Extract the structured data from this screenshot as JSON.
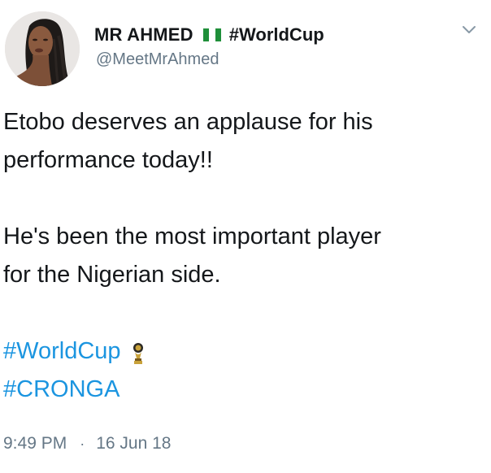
{
  "author": {
    "display_name": "MR AHMED",
    "flag_icon": "nigeria-flag-icon",
    "name_hashtag": "#WorldCup",
    "handle": "@MeetMrAhmed",
    "avatar_icon": "profile-avatar"
  },
  "menu": {
    "icon": "chevron-down-icon"
  },
  "tweet": {
    "paragraph1_line1": "Etobo deserves an applause for his",
    "paragraph1_line2": "performance today!!",
    "paragraph2_line1": "He's been the most important player",
    "paragraph2_line2": "for the Nigerian side.",
    "hashtag1": "#WorldCup",
    "hashtag1_icon": "world-cup-trophy-icon",
    "hashtag2": "#CRONGA"
  },
  "meta": {
    "time": "9:49 PM",
    "separator": "·",
    "date": "16 Jun 18"
  },
  "colors": {
    "link": "#1b95e0",
    "text": "#14171a",
    "muted": "#657786",
    "flag_green": "#1f8f3a"
  }
}
